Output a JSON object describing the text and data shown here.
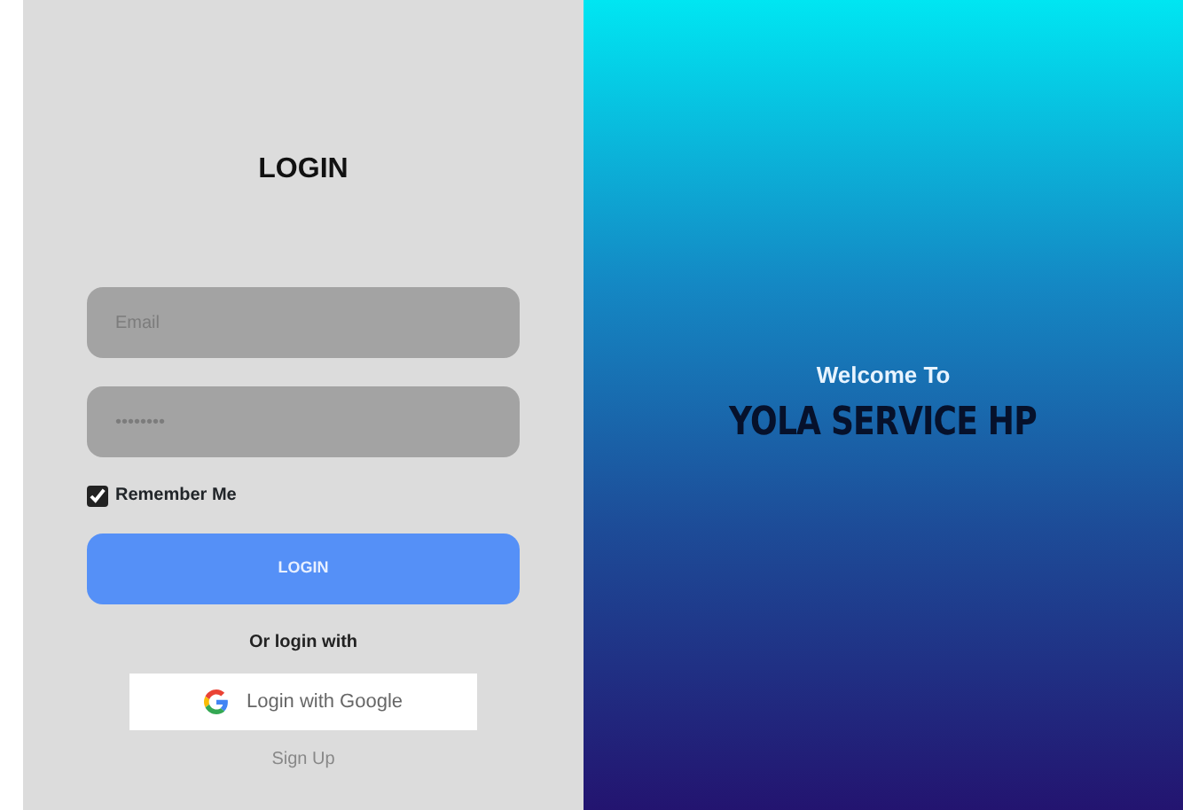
{
  "login": {
    "title": "LOGIN",
    "email": {
      "placeholder": "Email"
    },
    "password": {
      "placeholder": "••••••••"
    },
    "remember": {
      "label": "Remember Me",
      "checked": true
    },
    "submit": "LOGIN",
    "alt_text": "Or login with",
    "google_button": "Login with Google",
    "signup": "Sign Up"
  },
  "welcome": {
    "greeting": "Welcome To",
    "brand": "YOLA SERVICE HP"
  }
}
